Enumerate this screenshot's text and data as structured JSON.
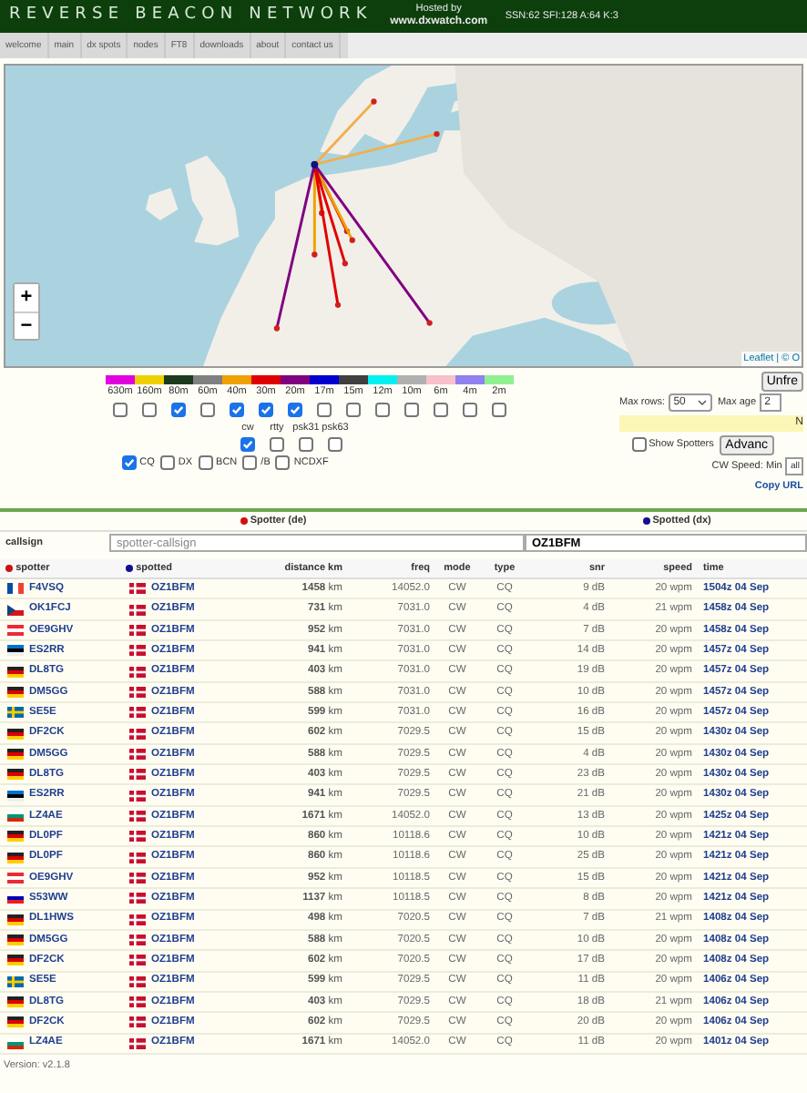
{
  "header": {
    "title": "REVERSE BEACON NETWORK",
    "hosted_label": "Hosted by",
    "hosted_link": "www.dxwatch.com",
    "solar": "SSN:62 SFI:128 A:64 K:3"
  },
  "nav": [
    "welcome",
    "main",
    "dx spots",
    "nodes",
    "FT8",
    "downloads",
    "about",
    "contact us"
  ],
  "map": {
    "kind": "picture",
    "zoom_in": "+",
    "zoom_out": "−",
    "attribution": "Leaflet | © O"
  },
  "bands": [
    {
      "label": "630m",
      "color": "#e000e0",
      "checked": false
    },
    {
      "label": "160m",
      "color": "#f0d000",
      "checked": false
    },
    {
      "label": "80m",
      "color": "#1e3a1e",
      "checked": true
    },
    {
      "label": "60m",
      "color": "#808080",
      "checked": false
    },
    {
      "label": "40m",
      "color": "#f0a000",
      "checked": true
    },
    {
      "label": "30m",
      "color": "#e00000",
      "checked": true
    },
    {
      "label": "20m",
      "color": "#800080",
      "checked": true
    },
    {
      "label": "17m",
      "color": "#0000d0",
      "checked": false
    },
    {
      "label": "15m",
      "color": "#404040",
      "checked": false
    },
    {
      "label": "12m",
      "color": "#00f0f0",
      "checked": false
    },
    {
      "label": "10m",
      "color": "#b0b0b0",
      "checked": false
    },
    {
      "label": "6m",
      "color": "#f8c0c8",
      "checked": false
    },
    {
      "label": "4m",
      "color": "#9080f0",
      "checked": false
    },
    {
      "label": "2m",
      "color": "#90f090",
      "checked": false
    }
  ],
  "modes": [
    {
      "label": "cw",
      "checked": true
    },
    {
      "label": "rtty",
      "checked": false
    },
    {
      "label": "psk31",
      "checked": false
    },
    {
      "label": "psk63",
      "checked": false
    }
  ],
  "types": [
    {
      "label": "CQ",
      "checked": true
    },
    {
      "label": "DX",
      "checked": false
    },
    {
      "label": "BCN",
      "checked": false
    },
    {
      "label": "/B",
      "checked": false
    },
    {
      "label": "NCDXF",
      "checked": false
    }
  ],
  "controls": {
    "unfreeze": "Unfre",
    "max_rows_label": "Max rows:",
    "max_rows": "50",
    "max_age_label": "Max age",
    "max_age": "2",
    "notice": "N",
    "show_spotters": {
      "label": "Show Spotters",
      "checked": false
    },
    "advanced": "Advanc",
    "cw_speed_label": "CW Speed:",
    "min_label": "Min",
    "min_value": "all",
    "copy_url": "Copy URL"
  },
  "spotter_heading": "Spotter (de)",
  "spotted_heading": "Spotted (dx)",
  "callsign": {
    "label": "callsign",
    "spotter_placeholder": "spotter-callsign",
    "spotted_value": "OZ1BFM"
  },
  "table": {
    "columns": [
      "spotter",
      "spotted",
      "distance km",
      "freq",
      "mode",
      "type",
      "snr",
      "speed",
      "time"
    ],
    "rows": [
      {
        "spotter": "F4VSQ",
        "spotter_flag": {
          "kind": "fr"
        },
        "spotted": "OZ1BFM",
        "spotted_flag": {
          "kind": "dk"
        },
        "distance": "**1458** km",
        "freq": "14052.0",
        "mode": "CW",
        "type": "CQ",
        "snr": "9 dB",
        "speed": "20 wpm",
        "time": "1504z 04 Sep"
      },
      {
        "spotter": "OK1FCJ",
        "spotter_flag": {
          "kind": "cz"
        },
        "spotted": "OZ1BFM",
        "spotted_flag": {
          "kind": "dk"
        },
        "distance": "**731** km",
        "freq": "7031.0",
        "mode": "CW",
        "type": "CQ",
        "snr": "4 dB",
        "speed": "21 wpm",
        "time": "1458z 04 Sep"
      },
      {
        "spotter": "OE9GHV",
        "spotter_flag": {
          "kind": "at"
        },
        "spotted": "OZ1BFM",
        "spotted_flag": {
          "kind": "dk"
        },
        "distance": "**952** km",
        "freq": "7031.0",
        "mode": "CW",
        "type": "CQ",
        "snr": "7 dB",
        "speed": "20 wpm",
        "time": "1458z 04 Sep"
      },
      {
        "spotter": "ES2RR",
        "spotter_flag": {
          "kind": "ee"
        },
        "spotted": "OZ1BFM",
        "spotted_flag": {
          "kind": "dk"
        },
        "distance": "**941** km",
        "freq": "7031.0",
        "mode": "CW",
        "type": "CQ",
        "snr": "14 dB",
        "speed": "20 wpm",
        "time": "1457z 04 Sep"
      },
      {
        "spotter": "DL8TG",
        "spotter_flag": {
          "kind": "de"
        },
        "spotted": "OZ1BFM",
        "spotted_flag": {
          "kind": "dk"
        },
        "distance": "**403** km",
        "freq": "7031.0",
        "mode": "CW",
        "type": "CQ",
        "snr": "19 dB",
        "speed": "20 wpm",
        "time": "1457z 04 Sep"
      },
      {
        "spotter": "DM5GG",
        "spotter_flag": {
          "kind": "de"
        },
        "spotted": "OZ1BFM",
        "spotted_flag": {
          "kind": "dk"
        },
        "distance": "**588** km",
        "freq": "7031.0",
        "mode": "CW",
        "type": "CQ",
        "snr": "10 dB",
        "speed": "20 wpm",
        "time": "1457z 04 Sep"
      },
      {
        "spotter": "SE5E",
        "spotter_flag": {
          "kind": "se"
        },
        "spotted": "OZ1BFM",
        "spotted_flag": {
          "kind": "dk"
        },
        "distance": "**599** km",
        "freq": "7031.0",
        "mode": "CW",
        "type": "CQ",
        "snr": "16 dB",
        "speed": "20 wpm",
        "time": "1457z 04 Sep"
      },
      {
        "spotter": "DF2CK",
        "spotter_flag": {
          "kind": "de"
        },
        "spotted": "OZ1BFM",
        "spotted_flag": {
          "kind": "dk"
        },
        "distance": "**602** km",
        "freq": "7029.5",
        "mode": "CW",
        "type": "CQ",
        "snr": "15 dB",
        "speed": "20 wpm",
        "time": "1430z 04 Sep"
      },
      {
        "spotter": "DM5GG",
        "spotter_flag": {
          "kind": "de"
        },
        "spotted": "OZ1BFM",
        "spotted_flag": {
          "kind": "dk"
        },
        "distance": "**588** km",
        "freq": "7029.5",
        "mode": "CW",
        "type": "CQ",
        "snr": "4 dB",
        "speed": "20 wpm",
        "time": "1430z 04 Sep"
      },
      {
        "spotter": "DL8TG",
        "spotter_flag": {
          "kind": "de"
        },
        "spotted": "OZ1BFM",
        "spotted_flag": {
          "kind": "dk"
        },
        "distance": "**403** km",
        "freq": "7029.5",
        "mode": "CW",
        "type": "CQ",
        "snr": "23 dB",
        "speed": "20 wpm",
        "time": "1430z 04 Sep"
      },
      {
        "spotter": "ES2RR",
        "spotter_flag": {
          "kind": "ee"
        },
        "spotted": "OZ1BFM",
        "spotted_flag": {
          "kind": "dk"
        },
        "distance": "**941** km",
        "freq": "7029.5",
        "mode": "CW",
        "type": "CQ",
        "snr": "21 dB",
        "speed": "20 wpm",
        "time": "1430z 04 Sep"
      },
      {
        "spotter": "LZ4AE",
        "spotter_flag": {
          "kind": "bg"
        },
        "spotted": "OZ1BFM",
        "spotted_flag": {
          "kind": "dk"
        },
        "distance": "**1671** km",
        "freq": "14052.0",
        "mode": "CW",
        "type": "CQ",
        "snr": "13 dB",
        "speed": "20 wpm",
        "time": "1425z 04 Sep"
      },
      {
        "spotter": "DL0PF",
        "spotter_flag": {
          "kind": "de"
        },
        "spotted": "OZ1BFM",
        "spotted_flag": {
          "kind": "dk"
        },
        "distance": "**860** km",
        "freq": "10118.6",
        "mode": "CW",
        "type": "CQ",
        "snr": "10 dB",
        "speed": "20 wpm",
        "time": "1421z 04 Sep"
      },
      {
        "spotter": "DL0PF",
        "spotter_flag": {
          "kind": "de"
        },
        "spotted": "OZ1BFM",
        "spotted_flag": {
          "kind": "dk"
        },
        "distance": "**860** km",
        "freq": "10118.6",
        "mode": "CW",
        "type": "CQ",
        "snr": "25 dB",
        "speed": "20 wpm",
        "time": "1421z 04 Sep"
      },
      {
        "spotter": "OE9GHV",
        "spotter_flag": {
          "kind": "at"
        },
        "spotted": "OZ1BFM",
        "spotted_flag": {
          "kind": "dk"
        },
        "distance": "**952** km",
        "freq": "10118.5",
        "mode": "CW",
        "type": "CQ",
        "snr": "15 dB",
        "speed": "20 wpm",
        "time": "1421z 04 Sep"
      },
      {
        "spotter": "S53WW",
        "spotter_flag": {
          "kind": "si"
        },
        "spotted": "OZ1BFM",
        "spotted_flag": {
          "kind": "dk"
        },
        "distance": "**1137** km",
        "freq": "10118.5",
        "mode": "CW",
        "type": "CQ",
        "snr": "8 dB",
        "speed": "20 wpm",
        "time": "1421z 04 Sep"
      },
      {
        "spotter": "DL1HWS",
        "spotter_flag": {
          "kind": "de"
        },
        "spotted": "OZ1BFM",
        "spotted_flag": {
          "kind": "dk"
        },
        "distance": "**498** km",
        "freq": "7020.5",
        "mode": "CW",
        "type": "CQ",
        "snr": "7 dB",
        "speed": "21 wpm",
        "time": "1408z 04 Sep"
      },
      {
        "spotter": "DM5GG",
        "spotter_flag": {
          "kind": "de"
        },
        "spotted": "OZ1BFM",
        "spotted_flag": {
          "kind": "dk"
        },
        "distance": "**588** km",
        "freq": "7020.5",
        "mode": "CW",
        "type": "CQ",
        "snr": "10 dB",
        "speed": "20 wpm",
        "time": "1408z 04 Sep"
      },
      {
        "spotter": "DF2CK",
        "spotter_flag": {
          "kind": "de"
        },
        "spotted": "OZ1BFM",
        "spotted_flag": {
          "kind": "dk"
        },
        "distance": "**602** km",
        "freq": "7020.5",
        "mode": "CW",
        "type": "CQ",
        "snr": "17 dB",
        "speed": "20 wpm",
        "time": "1408z 04 Sep"
      },
      {
        "spotter": "SE5E",
        "spotter_flag": {
          "kind": "se"
        },
        "spotted": "OZ1BFM",
        "spotted_flag": {
          "kind": "dk"
        },
        "distance": "**599** km",
        "freq": "7029.5",
        "mode": "CW",
        "type": "CQ",
        "snr": "11 dB",
        "speed": "20 wpm",
        "time": "1406z 04 Sep"
      },
      {
        "spotter": "DL8TG",
        "spotter_flag": {
          "kind": "de"
        },
        "spotted": "OZ1BFM",
        "spotted_flag": {
          "kind": "dk"
        },
        "distance": "**403** km",
        "freq": "7029.5",
        "mode": "CW",
        "type": "CQ",
        "snr": "18 dB",
        "speed": "21 wpm",
        "time": "1406z 04 Sep"
      },
      {
        "spotter": "DF2CK",
        "spotter_flag": {
          "kind": "de"
        },
        "spotted": "OZ1BFM",
        "spotted_flag": {
          "kind": "dk"
        },
        "distance": "**602** km",
        "freq": "7029.5",
        "mode": "CW",
        "type": "CQ",
        "snr": "20 dB",
        "speed": "20 wpm",
        "time": "1406z 04 Sep"
      },
      {
        "spotter": "LZ4AE",
        "spotter_flag": {
          "kind": "bg"
        },
        "spotted": "OZ1BFM",
        "spotted_flag": {
          "kind": "dk"
        },
        "distance": "**1671** km",
        "freq": "14052.0",
        "mode": "CW",
        "type": "CQ",
        "snr": "11 dB",
        "speed": "20 wpm",
        "time": "1401z 04 Sep"
      }
    ]
  },
  "version": "Version: v2.1.8"
}
